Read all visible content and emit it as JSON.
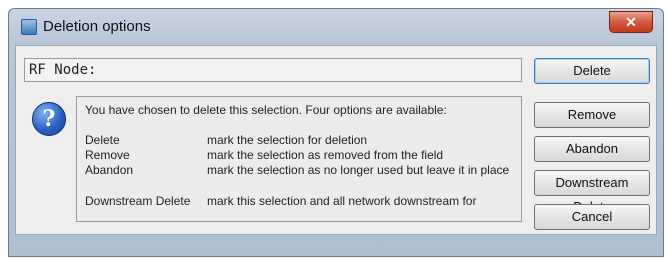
{
  "window": {
    "title": "Deletion options",
    "close_glyph": "✕",
    "title_icon": "app-icon"
  },
  "node_field": {
    "value": "RF Node:"
  },
  "message": {
    "icon": "question-icon",
    "intro": "You have chosen to delete this selection.  Four options are available:",
    "options": [
      {
        "term": "Delete",
        "description": "mark the selection for deletion"
      },
      {
        "term": "Remove",
        "description": "mark the selection as removed from the field"
      },
      {
        "term": "Abandon",
        "description": "mark the selection as no longer used but leave it in place"
      },
      {
        "term": "Downstream Delete",
        "description": "mark this selection and all network downstream for"
      }
    ]
  },
  "buttons": {
    "delete": "Delete",
    "remove": "Remove",
    "abandon": "Abandon",
    "downstream_delete": "Downstream Delete",
    "cancel": "Cancel"
  }
}
